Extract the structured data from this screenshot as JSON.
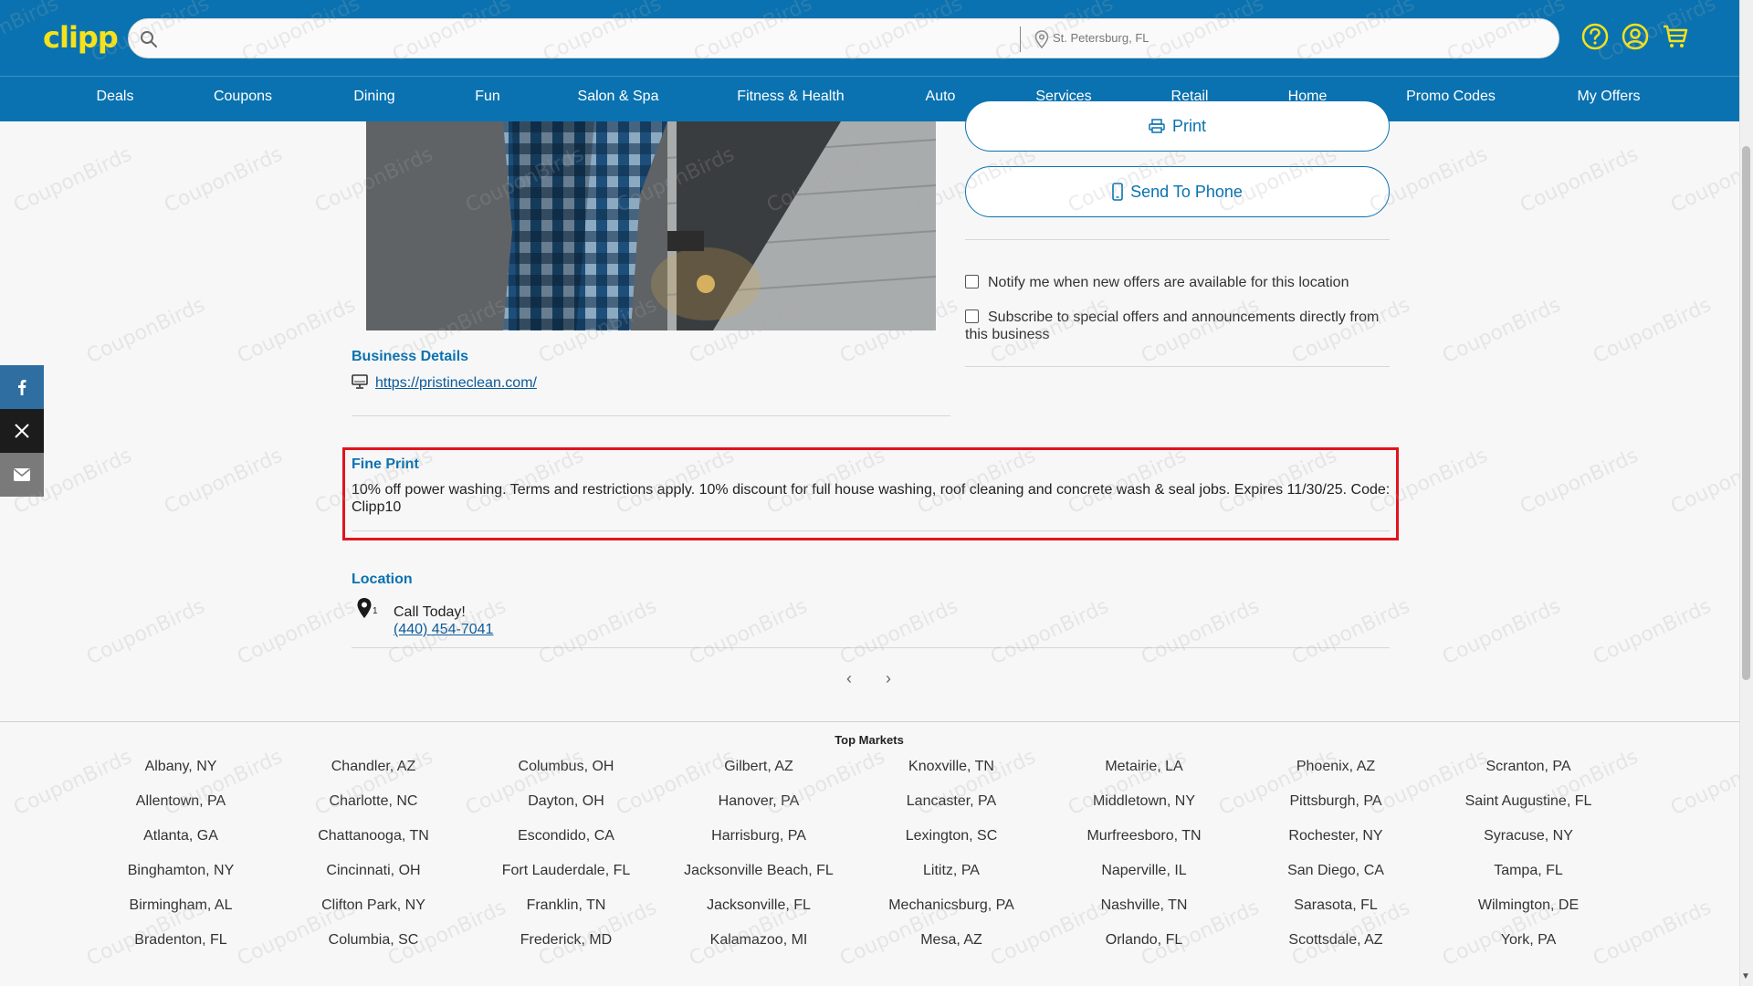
{
  "header": {
    "logo_text": "clipp",
    "search": {
      "placeholder": "",
      "value": ""
    },
    "location": "St. Petersburg, FL",
    "icons": [
      "help-icon",
      "account-icon",
      "cart-icon"
    ]
  },
  "nav": {
    "items": [
      {
        "label": "Deals"
      },
      {
        "label": "Coupons"
      },
      {
        "label": "Dining"
      },
      {
        "label": "Fun"
      },
      {
        "label": "Salon & Spa"
      },
      {
        "label": "Fitness & Health"
      },
      {
        "label": "Auto"
      },
      {
        "label": "Services"
      },
      {
        "label": "Retail"
      },
      {
        "label": "Home"
      },
      {
        "label": "Promo Codes"
      },
      {
        "label": "My Offers"
      }
    ]
  },
  "social": [
    "facebook-icon",
    "x-icon",
    "email-icon"
  ],
  "offer": {
    "print_label": "Print",
    "send_to_phone_label": "Send To Phone",
    "notify_label": "Notify me when new offers are available for this location",
    "subscribe_label": "Subscribe to special offers and announcements directly from this business"
  },
  "business": {
    "title": "Business Details",
    "url": "https://pristineclean.com/"
  },
  "fine_print": {
    "title": "Fine Print",
    "text": "10% off power washing. Terms and restrictions apply. 10% discount for full house washing, roof cleaning and concrete wash & seal jobs. Expires 11/30/25. Code: Clipp10"
  },
  "location": {
    "title": "Location",
    "pin_number": "1",
    "call_label": "Call Today!",
    "phone": "(440) 454-7041"
  },
  "pager": {
    "prev": "‹",
    "next": "›"
  },
  "footer": {
    "top_markets_title": "Top Markets",
    "markets": [
      [
        "Albany, NY",
        "Allentown, PA",
        "Atlanta, GA",
        "Binghamton, NY",
        "Birmingham, AL",
        "Bradenton, FL"
      ],
      [
        "Chandler, AZ",
        "Charlotte, NC",
        "Chattanooga, TN",
        "Cincinnati, OH",
        "Clifton Park, NY",
        "Columbia, SC"
      ],
      [
        "Columbus, OH",
        "Dayton, OH",
        "Escondido, CA",
        "Fort Lauderdale, FL",
        "Franklin, TN",
        "Frederick, MD"
      ],
      [
        "Gilbert, AZ",
        "Hanover, PA",
        "Harrisburg, PA",
        "Jacksonville Beach, FL",
        "Jacksonville, FL",
        "Kalamazoo, MI"
      ],
      [
        "Knoxville, TN",
        "Lancaster, PA",
        "Lexington, SC",
        "Lititz, PA",
        "Mechanicsburg, PA",
        "Mesa, AZ"
      ],
      [
        "Metairie, LA",
        "Middletown, NY",
        "Murfreesboro, TN",
        "Naperville, IL",
        "Nashville, TN",
        "Orlando, FL"
      ],
      [
        "Phoenix, AZ",
        "Pittsburgh, PA",
        "Rochester, NY",
        "San Diego, CA",
        "Sarasota, FL",
        "Scottsdale, AZ"
      ],
      [
        "Scranton, PA",
        "Saint Augustine, FL",
        "Syracuse, NY",
        "Tampa, FL",
        "Wilmington, DE",
        "York, PA"
      ]
    ]
  },
  "watermark": "CouponBirds",
  "colors": {
    "brand_blue": "#0a72b0",
    "logo_yellow": "#f5e21a",
    "highlight_red": "#e0141f",
    "link_blue": "#0a5a9b"
  }
}
